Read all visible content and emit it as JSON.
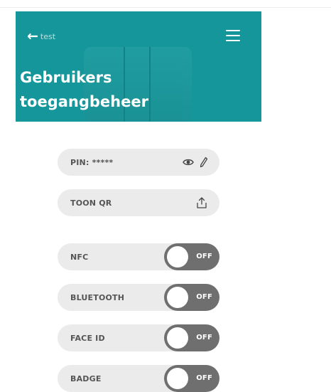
{
  "header": {
    "back_label": "test",
    "title_line1": "Gebruikers",
    "title_line2": "toegangbeheer"
  },
  "pin": {
    "label": "PIN: *****",
    "icons": [
      "eye-icon",
      "pencil-icon"
    ]
  },
  "qr": {
    "label": "TOON QR",
    "icon": "share-upload-icon"
  },
  "toggles": [
    {
      "label": "NFC",
      "state": "OFF"
    },
    {
      "label": "BLUETOOTH",
      "state": "OFF"
    },
    {
      "label": "FACE ID",
      "state": "OFF"
    },
    {
      "label": "BADGE",
      "state": "OFF"
    }
  ],
  "colors": {
    "header_bg": "#14969a",
    "pill_bg": "#ebebeb",
    "toggle_off_bg": "#6f6f6f"
  }
}
